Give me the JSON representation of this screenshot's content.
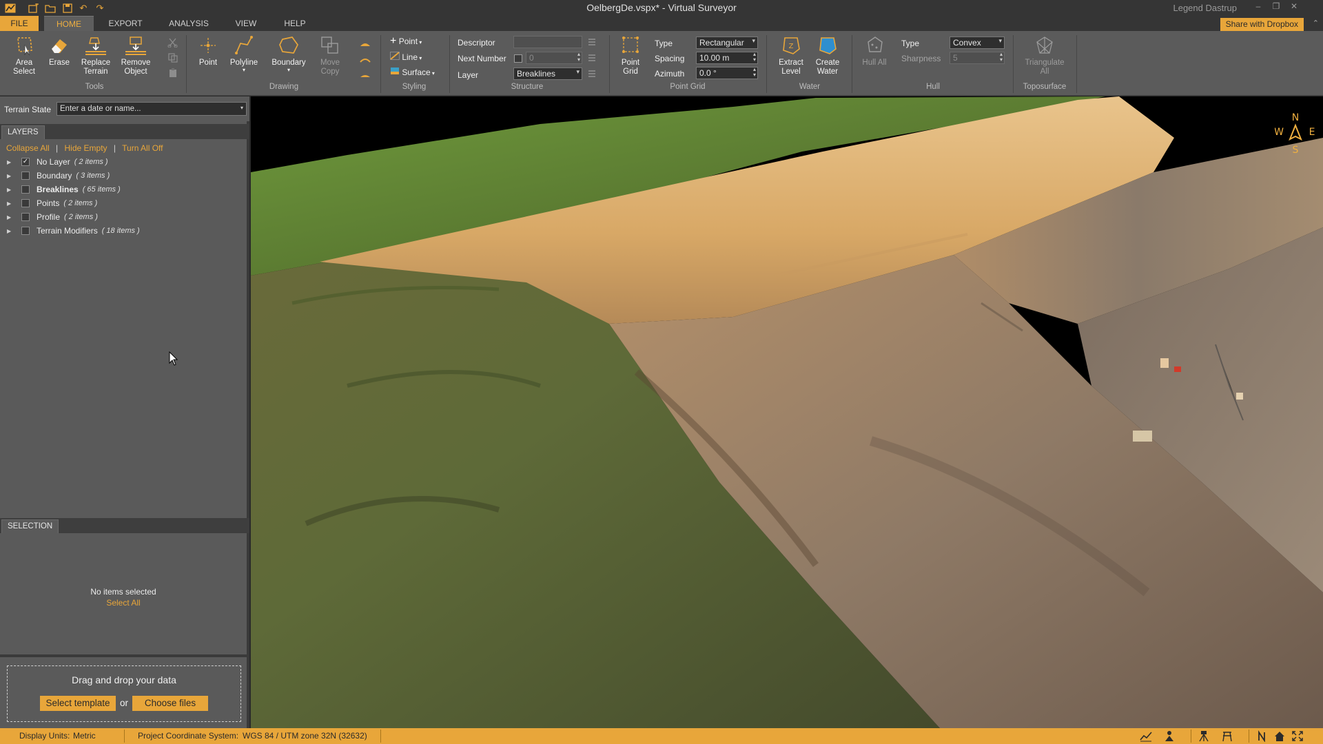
{
  "window": {
    "title": "OelbergDe.vspx* - Virtual Surveyor",
    "user": "Legend Dastrup",
    "share_button": "Share with Dropbox"
  },
  "tabs": [
    "FILE",
    "HOME",
    "EXPORT",
    "ANALYSIS",
    "VIEW",
    "HELP"
  ],
  "ribbon": {
    "tools": {
      "label": "Tools",
      "area_select": "Area Select",
      "erase": "Erase",
      "replace_terrain": "Replace Terrain",
      "remove_object": "Remove Object"
    },
    "drawing": {
      "label": "Drawing",
      "point": "Point",
      "polyline": "Polyline",
      "boundary": "Boundary",
      "move_copy": "Move Copy"
    },
    "styling": {
      "label": "Styling",
      "point": "Point",
      "line": "Line",
      "surface": "Surface"
    },
    "structure": {
      "label": "Structure",
      "descriptor_label": "Descriptor",
      "descriptor_value": "",
      "next_number_label": "Next Number",
      "next_number_value": "0",
      "layer_label": "Layer",
      "layer_value": "Breaklines"
    },
    "point_grid": {
      "label": "Point Grid",
      "button": "Point Grid",
      "type_label": "Type",
      "type_value": "Rectangular",
      "spacing_label": "Spacing",
      "spacing_value": "10.00 m",
      "azimuth_label": "Azimuth",
      "azimuth_value": "0.0 °"
    },
    "water": {
      "label": "Water",
      "extract_level": "Extract Level",
      "create_water": "Create Water"
    },
    "hull": {
      "label": "Hull",
      "hull_all": "Hull All",
      "type_label": "Type",
      "type_value": "Convex",
      "sharpness_label": "Sharpness",
      "sharpness_value": "5"
    },
    "toposurface": {
      "label": "Toposurface",
      "triangulate_all": "Triangulate All"
    }
  },
  "left_panel": {
    "terrain_state_label": "Terrain State",
    "terrain_state_placeholder": "Enter a date or name...",
    "layers_tab": "LAYERS",
    "links": {
      "collapse_all": "Collapse All",
      "hide_empty": "Hide Empty",
      "turn_all_off": "Turn All Off",
      "pipe": "|"
    },
    "layers": [
      {
        "name": "No Layer",
        "count": "( 2 items )",
        "checked": true
      },
      {
        "name": "Boundary",
        "count": "( 3 items )",
        "checked": false
      },
      {
        "name": "Breaklines",
        "count": "( 65 items )",
        "checked": false
      },
      {
        "name": "Points",
        "count": "( 2 items )",
        "checked": false
      },
      {
        "name": "Profile",
        "count": "( 2 items )",
        "checked": false
      },
      {
        "name": "Terrain Modifiers",
        "count": "( 18 items )",
        "checked": false
      }
    ],
    "selection_tab": "SELECTION",
    "no_items": "No items selected",
    "select_all": "Select All",
    "drop_zone": {
      "title": "Drag and drop your data",
      "select_template": "Select template",
      "or": "or",
      "choose_files": "Choose files"
    }
  },
  "compass": {
    "n": "N",
    "s": "S",
    "e": "E",
    "w": "W"
  },
  "status_bar": {
    "display_units_label": "Display Units:",
    "display_units_value": "Metric",
    "crs_label": "Project Coordinate System:",
    "crs_value": "WGS 84 / UTM zone 32N (32632)"
  },
  "colors": {
    "accent": "#e8a63a",
    "ribbon_bg": "#5b5b5b",
    "panel_bg": "#5a5a5a",
    "titlebar_bg": "#353535"
  }
}
